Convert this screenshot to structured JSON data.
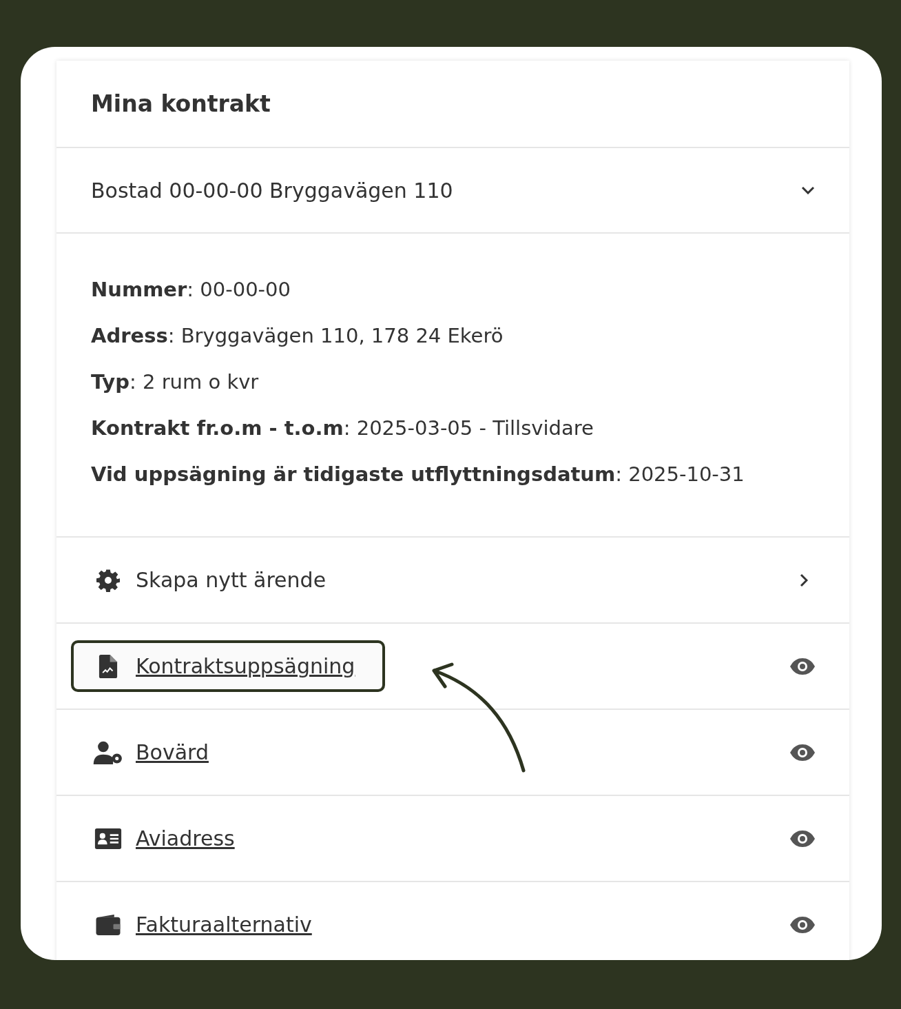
{
  "title": "Mina kontrakt",
  "contract_select": {
    "value": "Bostad 00-00-00 Bryggavägen 110",
    "expanded": false
  },
  "details": [
    {
      "text": "**Nummer**: 00-00-00"
    },
    {
      "text": "**Adress**: Bryggavägen 110, 178 24 Ekerö"
    },
    {
      "text": "**Typ**: 2 rum o kvr"
    },
    {
      "text": "**Kontrakt fr.o.m - t.o.m**: 2025-03-05 - Tillsvidare"
    },
    {
      "text": "**Vid uppsägning är tidigaste utflyttningsdatum**: 2025-10-31"
    }
  ],
  "actions": [
    {
      "label": "Skapa nytt ärende",
      "kind": "menu",
      "highlighted": false
    },
    {
      "label": "Kontraktsuppsägning",
      "kind": "link",
      "highlighted": true
    },
    {
      "label": "Bovärd",
      "kind": "link",
      "highlighted": false
    },
    {
      "label": "Aviadress",
      "kind": "link",
      "highlighted": false
    },
    {
      "label": "Fakturaalternativ",
      "kind": "link",
      "highlighted": false
    }
  ]
}
